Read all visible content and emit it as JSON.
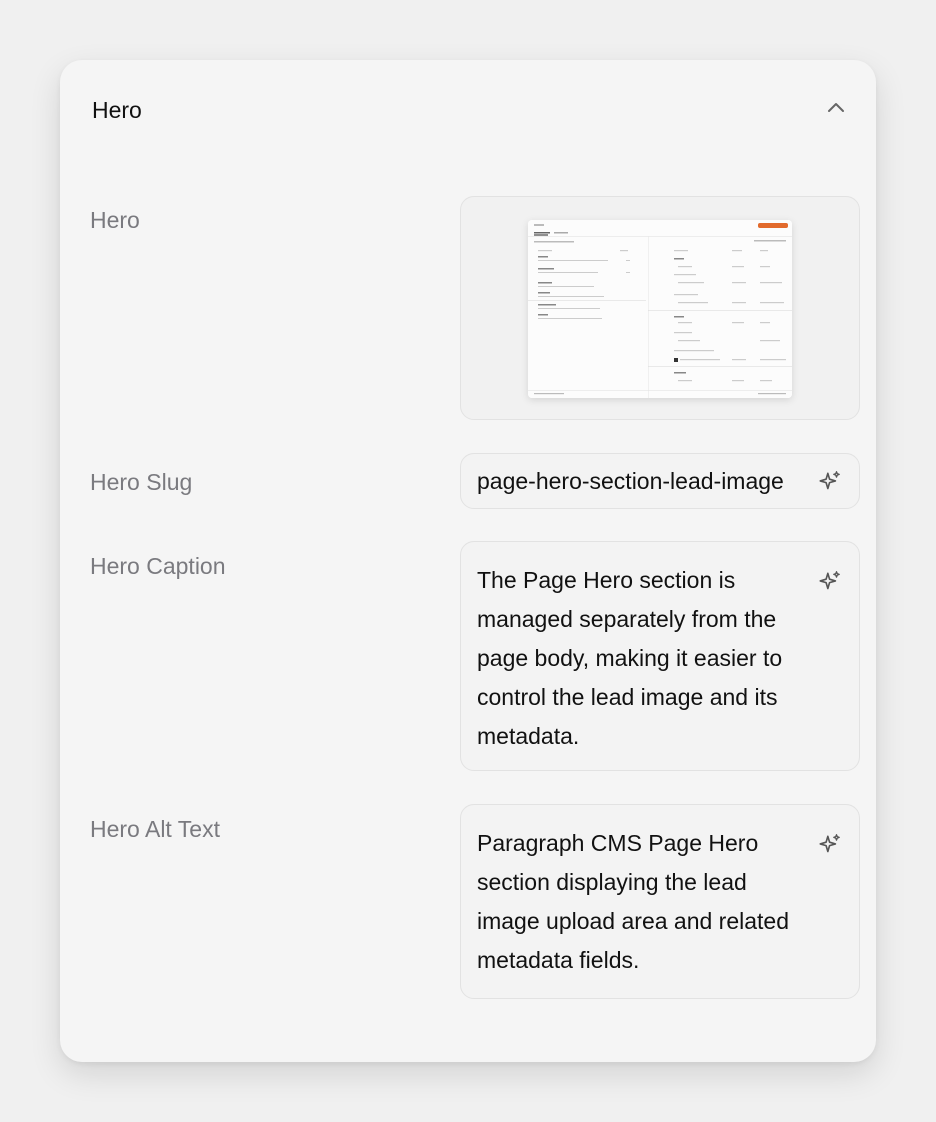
{
  "section": {
    "title": "Hero"
  },
  "fields": {
    "hero_label": "Hero",
    "slug_label": "Hero Slug",
    "slug_value": "page-hero-section-lead-image",
    "caption_label": "Hero Caption",
    "caption_value": "The Page Hero section is managed separately from the page body, making it easier to control the lead image and its metadata.",
    "alt_label": "Hero Alt Text",
    "alt_value": "Paragraph CMS Page Hero section displaying the lead image upload area and related metadata fields."
  },
  "icons": {
    "collapse": "chevron-up-icon",
    "ai_generate": "sparkles-icon"
  },
  "colors": {
    "accent": "#e26a2c",
    "label": "#7a7a7f",
    "text": "#111111"
  }
}
